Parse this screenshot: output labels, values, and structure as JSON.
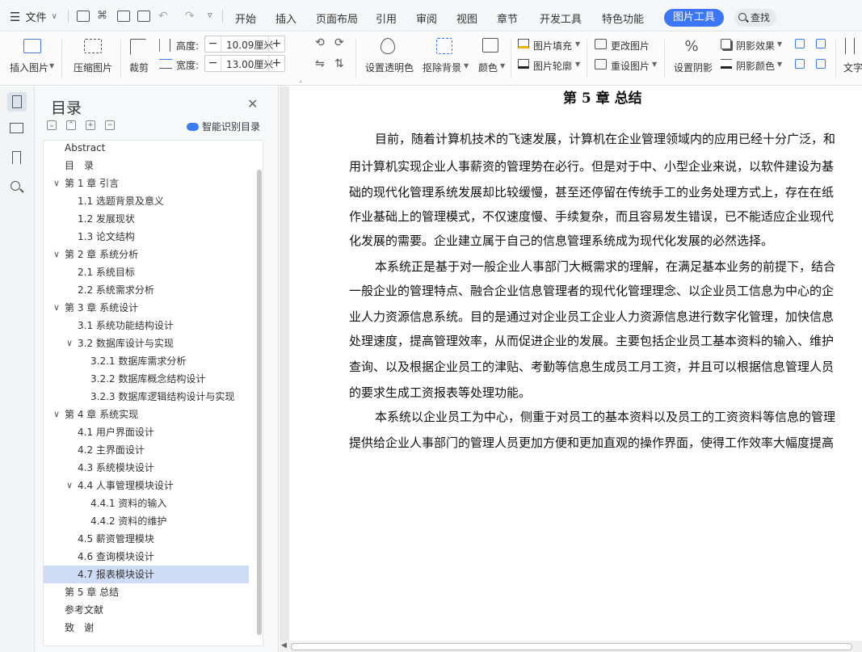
{
  "menubar": {
    "file_label": "文件",
    "tabs": [
      "开始",
      "插入",
      "页面布局",
      "引用",
      "审阅",
      "视图",
      "章节",
      "开发工具",
      "特色功能"
    ],
    "active_tab": "图片工具",
    "search_label": "查找"
  },
  "ribbon": {
    "insert_picture": "插入图片",
    "compress_picture": "压缩图片",
    "crop": "裁剪",
    "height_label": "高度:",
    "height_value": "10.09厘米",
    "width_label": "宽度:",
    "width_value": "13.00厘米",
    "set_transparent": "设置透明色",
    "remove_bg": "抠除背景",
    "color": "颜色",
    "picture_fill": "图片填充",
    "picture_outline": "图片轮廓",
    "change_picture": "更改图片",
    "reset_picture": "重设图片",
    "set_shadow": "设置阴影",
    "shadow_effect": "阴影效果",
    "shadow_color": "阴影颜色",
    "text_wrap": "文字"
  },
  "toc": {
    "title": "目录",
    "smart_label": "智能识别目录",
    "items": [
      {
        "label": "Abstract",
        "level": 0,
        "chev": false
      },
      {
        "label": "目　录",
        "level": 0,
        "chev": false
      },
      {
        "label": "第 1 章  引言",
        "level": 0,
        "chev": true
      },
      {
        "label": "1.1 选题背景及意义",
        "level": 1,
        "chev": false
      },
      {
        "label": "1.2 发展现状",
        "level": 1,
        "chev": false
      },
      {
        "label": "1.3 论文结构",
        "level": 1,
        "chev": false
      },
      {
        "label": "第 2 章  系统分析",
        "level": 0,
        "chev": true
      },
      {
        "label": "2.1  系统目标",
        "level": 1,
        "chev": false
      },
      {
        "label": "2.2  系统需求分析",
        "level": 1,
        "chev": false
      },
      {
        "label": "第 3 章  系统设计",
        "level": 0,
        "chev": true
      },
      {
        "label": "3.1  系统功能结构设计",
        "level": 1,
        "chev": false
      },
      {
        "label": "3.2  数据库设计与实现",
        "level": 1,
        "chev": true
      },
      {
        "label": "3.2.1 数据库需求分析",
        "level": 2,
        "chev": false
      },
      {
        "label": "3.2.2 数据库概念结构设计",
        "level": 2,
        "chev": false
      },
      {
        "label": "3.2.3 数据库逻辑结构设计与实现",
        "level": 2,
        "chev": false
      },
      {
        "label": "第 4 章  系统实现",
        "level": 0,
        "chev": true
      },
      {
        "label": "4.1  用户界面设计",
        "level": 1,
        "chev": false
      },
      {
        "label": "4.2  主界面设计",
        "level": 1,
        "chev": false
      },
      {
        "label": "4.3  系统模块设计",
        "level": 1,
        "chev": false
      },
      {
        "label": "4.4  人事管理模块设计",
        "level": 1,
        "chev": true
      },
      {
        "label": "4.4.1  资料的输入",
        "level": 2,
        "chev": false
      },
      {
        "label": "4.4.2  资料的维护",
        "level": 2,
        "chev": false
      },
      {
        "label": "4.5  薪资管理模块",
        "level": 1,
        "chev": false
      },
      {
        "label": "4.6  查询模块设计",
        "level": 1,
        "chev": false
      },
      {
        "label": "4.7  报表模块设计",
        "level": 1,
        "chev": false,
        "selected": true
      },
      {
        "label": "第 5 章  总结",
        "level": 0,
        "chev": false
      },
      {
        "label": "参考文献",
        "level": 0,
        "chev": false
      },
      {
        "label": "致　谢",
        "level": 0,
        "chev": false
      }
    ]
  },
  "document": {
    "chapter_title": "第 5 章  总结",
    "lines": [
      "目前，随着计算机技术的飞速发展，计算机在企业管理领域内的应用已经十分广泛，和",
      "用计算机实现企业人事薪资的管理势在必行。但是对于中、小型企业来说，以软件建设为基",
      "础的现代化管理系统发展却比较缓慢，甚至还停留在传统手工的业务处理方式上，存在在纸",
      "作业基础上的管理模式，不仅速度慢、手续复杂，而且容易发生错误，已不能适应企业现代",
      "化发展的需要。企业建立属于自己的信息管理系统成为现代化发展的必然选择。",
      "本系统正是基于对一般企业人事部门大概需求的理解，在满足基本业务的前提下，结合",
      "一般企业的管理特点、融合企业信息管理者的现代化管理理念、以企业员工信息为中心的企",
      "业人力资源信息系统。目的是通过对企业员工企业人力资源信息进行数字化管理，加快信息",
      "处理速度，提高管理效率，从而促进企业的发展。主要包括企业员工基本资料的输入、维护",
      "查询、以及根据企业员工的津贴、考勤等信息生成员工月工资，并且可以根据信息管理人员",
      "的要求生成工资报表等处理功能。",
      "本系统以企业员工为中心，侧重于对员工的基本资料以及员工的工资资料等信息的管理",
      "提供给企业人事部门的管理人员更加方便和更加直观的操作界面，使得工作效率大幅度提高"
    ]
  }
}
